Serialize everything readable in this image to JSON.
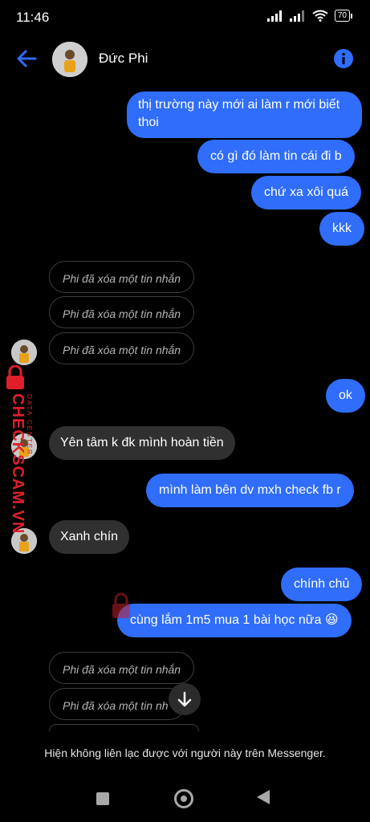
{
  "status_bar": {
    "time": "11:46",
    "battery": "70"
  },
  "header": {
    "contact_name": "Đức Phi"
  },
  "messages": {
    "m1": "thị trường này mới ai làm r mới biết",
    "m1b": "thoi",
    "m2": "có gì đó làm tin cái đi b",
    "m3": "chứ xa xôi quá",
    "m4": "kkk",
    "d1": "Phi đã xóa một tin nhắn",
    "d2": "Phi đã xóa một tin nhắn",
    "d3": "Phi đã xóa một tin nhắn",
    "m5": "ok",
    "m6": "Yên tâm k đk mình hoàn tiền",
    "m7": "mình làm bên dv mxh check fb r",
    "m8": "Xanh chín",
    "m9": "chính chủ",
    "m10": "cùng lắm 1m5 mua 1 bài học nữa 😆",
    "d4": "Phi đã xóa một tin nhắn",
    "d5": "Phi đã xóa một tin nh"
  },
  "watermark": {
    "text": "CHECKSCAM.VN",
    "small": "DATA CENTER"
  },
  "notice": "Hiện không liên lạc được với người này trên Messenger.",
  "colors": {
    "accent": "#2f6dfa",
    "received_bubble": "#303030",
    "watermark": "#e01f2a"
  }
}
